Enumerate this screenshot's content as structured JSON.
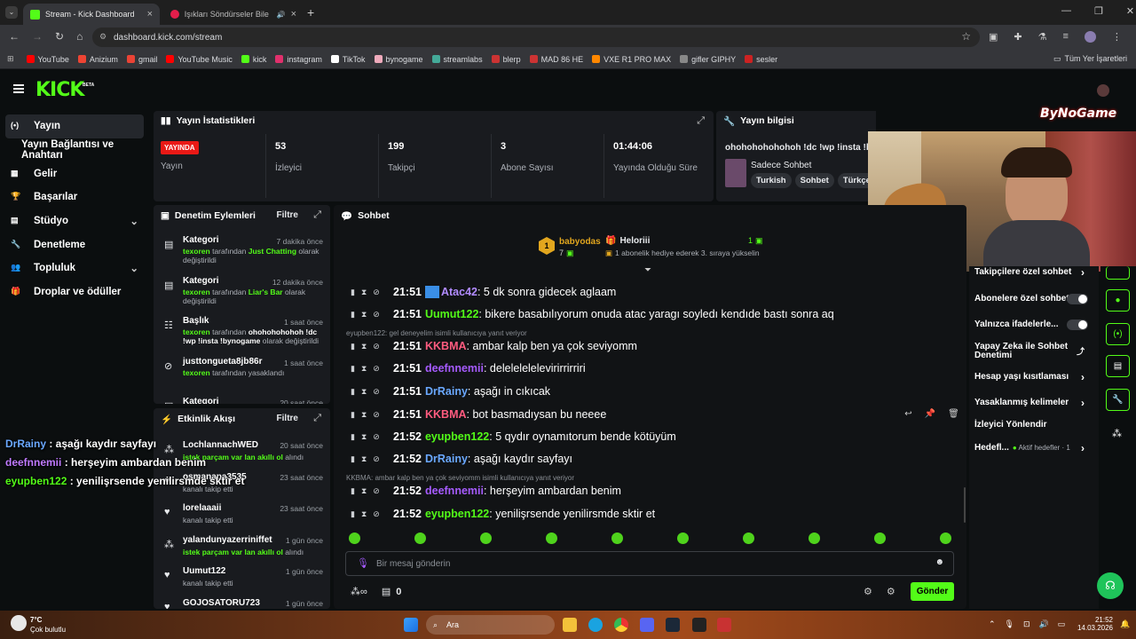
{
  "browser": {
    "tabs": [
      {
        "title": "Stream - Kick Dashboard",
        "active": true
      },
      {
        "title": "Işıkları Söndürseler Bile | Yo",
        "active": false
      }
    ],
    "url": "dashboard.kick.com/stream",
    "bookmarks": [
      "YouTube",
      "Anizium",
      "gmail",
      "YouTube Music",
      "kick",
      "instagram",
      "TikTok",
      "bynogame",
      "streamlabs",
      "blerp",
      "MAD 86 HE",
      "VXE R1 PRO MAX",
      "gifler GIPHY",
      "sesler"
    ],
    "all_bookmarks": "Tüm Yer İşaretleri"
  },
  "kick": {
    "logo": "KICK",
    "logo_tag": "BETA",
    "nav": [
      {
        "label": "Yayın",
        "active": true
      },
      {
        "label": "Yayın Bağlantısı ve Anahtarı",
        "sub": true
      },
      {
        "label": "Gelir"
      },
      {
        "label": "Başarılar"
      },
      {
        "label": "Stüdyo",
        "chevron": true
      },
      {
        "label": "Denetleme"
      },
      {
        "label": "Topluluk",
        "chevron": true
      },
      {
        "label": "Droplar ve ödüller"
      }
    ]
  },
  "stats": {
    "title": "Yayın İstatistikleri",
    "live_badge": "YAYINDA",
    "items": [
      {
        "value": "",
        "label": "Yayın"
      },
      {
        "value": "53",
        "label": "İzleyici"
      },
      {
        "value": "199",
        "label": "Takipçi"
      },
      {
        "value": "3",
        "label": "Abone Sayısı"
      },
      {
        "value": "01:44:06",
        "label": "Yayında Olduğu Süre"
      }
    ]
  },
  "info": {
    "title": "Yayın bilgisi",
    "stream_title": "ohohohohohohoh !dc !wp !insta !byı",
    "category": "Sadece Sohbet",
    "tags": [
      "Turkish",
      "Sohbet",
      "Türkçe"
    ]
  },
  "modlog": {
    "title": "Denetim Eylemleri",
    "filter": "Filtre",
    "items": [
      {
        "type": "Kategori",
        "time": "7 dakika önce",
        "who": "texoren",
        "pre": " tarafından ",
        "what": "Just Chatting",
        "post": " olarak değiştirildi"
      },
      {
        "type": "Kategori",
        "time": "12 dakika önce",
        "who": "texoren",
        "pre": " tarafından ",
        "what": "Liar's Bar",
        "post": " olarak değiştirildi"
      },
      {
        "type": "Başlık",
        "time": "1 saat önce",
        "who": "texoren",
        "pre": " tarafından ",
        "what": "ohohohohohoh !dc !wp !insta !bynogame",
        "post": " olarak değiştirildi"
      },
      {
        "type": "justtongueta8jb86r",
        "time": "1 saat önce",
        "who": "texoren",
        "pre": " tarafından yasaklandı",
        "what": "",
        "post": ""
      },
      {
        "type": "Kategori",
        "time": "20 saat önce",
        "who": "",
        "pre": "",
        "what": "",
        "post": ""
      }
    ]
  },
  "activity": {
    "title": "Etkinlik Akışı",
    "filter": "Filtre",
    "items": [
      {
        "name": "LochlannachWED",
        "time": "20 saat önce",
        "desc": "istek parçam var lan akıllı ol",
        "desc2": " alındı",
        "green": true
      },
      {
        "name": "osmanapa3535",
        "time": "23 saat önce",
        "desc": "kanalı takip etti",
        "desc2": "",
        "green": false
      },
      {
        "name": "lorelaaaii",
        "time": "23 saat önce",
        "desc": "kanalı takip etti",
        "desc2": "",
        "green": false
      },
      {
        "name": "yalandunyazerriniffet",
        "time": "1 gün önce",
        "desc": "istek parçam var lan akıllı ol",
        "desc2": " alındı",
        "green": true
      },
      {
        "name": "Uumut122",
        "time": "1 gün önce",
        "desc": "kanalı takip etti",
        "desc2": "",
        "green": false
      },
      {
        "name": "GOJOSATORU723",
        "time": "1 gün önce",
        "desc": "",
        "desc2": "",
        "green": false
      }
    ]
  },
  "chat": {
    "title": "Sohbet",
    "top_gifter": {
      "rank": "1",
      "name": "babyodas",
      "count": "7"
    },
    "sub_gift": {
      "name": "Heloriii",
      "count": "1",
      "text": "1 abonelik hediye ederek 3. sıraya yükselin"
    },
    "messages": [
      {
        "time": "21:51",
        "user": "Atac42",
        "color": "#b28cff",
        "text": ": 5 dk sonra gidecek aglaam"
      },
      {
        "time": "21:51",
        "user": "Uumut122",
        "color": "#53fc18",
        "text": ": bikere basabılıyorum onuda atac yaragı soyledı kendıde bastı sonra aq"
      },
      {
        "time": "21:51",
        "user": "KKBMA",
        "color": "#ff5b7f",
        "text": ": ambar kalp ben ya çok seviyomm",
        "reply": "eyupben122: gel deneyelim isimli kullanıcıya yanıt veriyor"
      },
      {
        "time": "21:51",
        "user": "deefnnemii",
        "color": "#a65bff",
        "text": ": delelelelelevirirrirriri"
      },
      {
        "time": "21:51",
        "user": "DrRainy",
        "color": "#6aa8ff",
        "text": ": aşağı in cıkıcak"
      },
      {
        "time": "21:51",
        "user": "KKBMA",
        "color": "#ff5b7f",
        "text": ": bot basmadıysan bu neeee"
      },
      {
        "time": "21:52",
        "user": "eyupben122",
        "color": "#53fc18",
        "text": ": 5 qydır oynamıtorum bende kötüyüm"
      },
      {
        "time": "21:52",
        "user": "DrRainy",
        "color": "#6aa8ff",
        "text": ": aşağı kaydır sayfayı"
      },
      {
        "time": "21:52",
        "user": "deefnnemii",
        "color": "#a65bff",
        "text": ": herşeyim ambardan benim",
        "reply": "KKBMA: ambar kalp ben ya çok seviyomm isimli kullanıcıya yanıt veriyor"
      },
      {
        "time": "21:52",
        "user": "eyupben122",
        "color": "#53fc18",
        "text": ": yenilişrsende yenilirsmde sktir et"
      }
    ],
    "placeholder": "Bir mesaj gönderin",
    "points": "0",
    "send": "Gönder"
  },
  "settings": {
    "items": [
      {
        "label": "Takipçilere özel sohbet",
        "kind": "chev"
      },
      {
        "label": "Abonelere özel sohbet",
        "kind": "toggle"
      },
      {
        "label": "Yalnızca ifadelerle...",
        "kind": "toggle"
      },
      {
        "label": "Yapay Zeka ile Sohbet Denetimi",
        "kind": "ext"
      },
      {
        "label": "Hesap yaşı kısıtlaması",
        "kind": "chev"
      },
      {
        "label": "Yasaklanmış kelimeler",
        "kind": "chev"
      },
      {
        "label": "İzleyici Yönlendir",
        "kind": "none"
      },
      {
        "label": "Hedefl...",
        "kind": "chev",
        "extra": "Aktif hedefler · 1"
      }
    ]
  },
  "overlay": {
    "brand": "ByNoGame",
    "lines": [
      {
        "user": "DrRainy",
        "color": "#6aa8ff",
        "text": " : aşağı kaydır sayfayı"
      },
      {
        "user": "deefnnemii",
        "color": "#c07bff",
        "text": " : herşeyim ambardan benim"
      },
      {
        "user": "eyupben122",
        "color": "#53fc18",
        "text": " : yenilişrsende yenilirsmde sktir et"
      }
    ]
  },
  "taskbar": {
    "temp": "7°C",
    "weather": "Çok bulutlu",
    "search": "Ara",
    "time": "21:52",
    "date": "14.03.2026"
  }
}
